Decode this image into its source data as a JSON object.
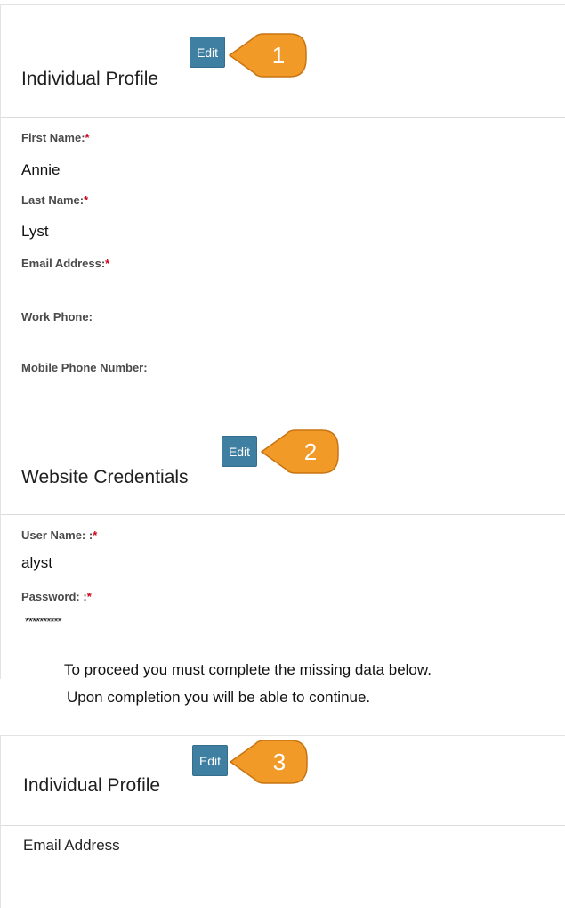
{
  "section1": {
    "title": "Individual Profile",
    "edit_label": "Edit",
    "callout_number": "1",
    "fields": [
      {
        "label": "First Name:",
        "required_mark": "*",
        "value": "Annie"
      },
      {
        "label": "Last Name:",
        "required_mark": "*",
        "value": "Lyst"
      },
      {
        "label": "Email Address:",
        "required_mark": "*",
        "value": ""
      },
      {
        "label": "Work Phone:",
        "value": ""
      },
      {
        "label": "Mobile Phone Number:",
        "value": ""
      }
    ]
  },
  "section2": {
    "title": "Website Credentials",
    "edit_label": "Edit",
    "callout_number": "2",
    "fields": [
      {
        "label": "User Name: :",
        "required_mark": "*",
        "value": "alyst"
      },
      {
        "label": "Password: :",
        "required_mark": "*",
        "value": "**********"
      }
    ]
  },
  "notice": {
    "line1": "To proceed you must complete the missing data below.",
    "line2": "Upon completion you will be able to continue."
  },
  "section3": {
    "title": "Individual Profile",
    "edit_label": "Edit",
    "callout_number": "3",
    "fields": [
      {
        "label": "Email Address"
      }
    ]
  },
  "colors": {
    "edit_button": "#3f7fa1",
    "callout": "#f29a27",
    "required": "#d0021b"
  }
}
